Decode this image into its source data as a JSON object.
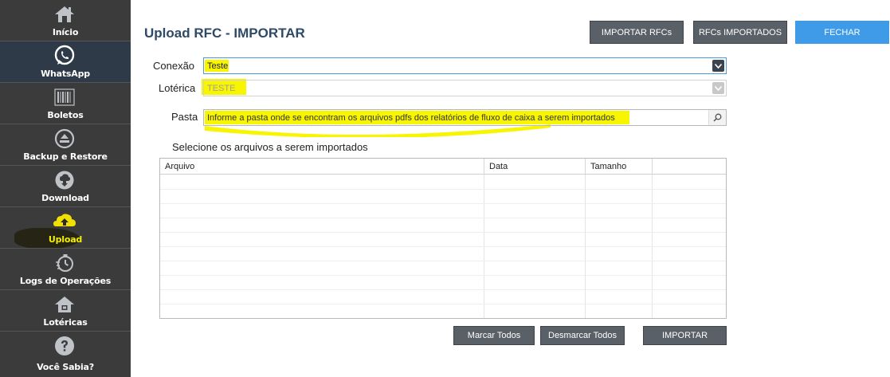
{
  "sidebar": {
    "items": [
      {
        "label": "Início",
        "icon": "home-icon"
      },
      {
        "label": "WhatsApp",
        "icon": "whatsapp-icon"
      },
      {
        "label": "Boletos",
        "icon": "barcode-icon"
      },
      {
        "label": "Backup e Restore",
        "icon": "backup-icon"
      },
      {
        "label": "Download",
        "icon": "download-icon"
      },
      {
        "label": "Upload",
        "icon": "upload-cloud-icon"
      },
      {
        "label": "Logs de Operações",
        "icon": "logs-icon"
      },
      {
        "label": "Lotéricas",
        "icon": "store-icon"
      },
      {
        "label": "Você Sabia?",
        "icon": "help-icon"
      }
    ],
    "active_index": 1
  },
  "header": {
    "title": "Upload RFC - IMPORTAR",
    "buttons": {
      "import_rfcs": "IMPORTAR RFCs",
      "imported_rfcs": "RFCs IMPORTADOS",
      "close": "FECHAR"
    }
  },
  "form": {
    "conexao": {
      "label": "Conexão",
      "value": "Teste"
    },
    "loterica": {
      "label": "Lotérica",
      "value": "TESTE"
    },
    "pasta": {
      "label": "Pasta",
      "placeholder": "Informe a pasta onde se encontram os arquivos pdfs dos relatórios de fluxo de caixa a serem importados"
    }
  },
  "files": {
    "heading": "Selecione os arquivos a serem importados",
    "columns": [
      "Arquivo",
      "Data",
      "Tamanho"
    ],
    "rows": []
  },
  "actions": {
    "mark_all": "Marcar Todos",
    "unmark_all": "Desmarcar Todos",
    "importar": "IMPORTAR"
  },
  "colors": {
    "sidebar_bg": "#3b3b3b",
    "active_bg": "#2e3a48",
    "title": "#2f4a66",
    "gray_button": "#596068",
    "close_button": "#3f9ae8",
    "highlight": "#f8f500"
  }
}
